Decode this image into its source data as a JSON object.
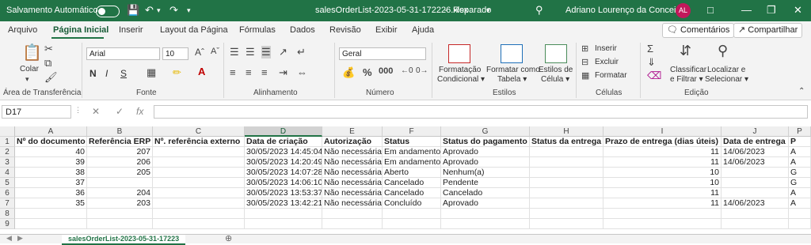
{
  "titlebar": {
    "autosave_label": "Salvamento Automático",
    "filename": "salesOrderList-2023-05-31-172226.xlsx",
    "status": "Reparado",
    "user_name": "Adriano Lourenço da Conceição",
    "user_initials": "AL"
  },
  "menu": {
    "items": [
      "Arquivo",
      "Página Inicial",
      "Inserir",
      "Layout da Página",
      "Fórmulas",
      "Dados",
      "Revisão",
      "Exibir",
      "Ajuda"
    ],
    "active": "Página Inicial",
    "comments_label": "Comentários",
    "share_label": "Compartilhar"
  },
  "ribbon": {
    "clipboard": {
      "paste_label": "Colar",
      "group_label": "Área de Transferência"
    },
    "font": {
      "font_name": "Arial",
      "font_size": "10",
      "bold": "N",
      "italic": "I",
      "underline": "S",
      "group_label": "Fonte"
    },
    "alignment": {
      "group_label": "Alinhamento"
    },
    "number": {
      "format": "Geral",
      "group_label": "Número"
    },
    "styles": {
      "conditional": [
        "Formatação",
        "Condicional ▾"
      ],
      "as_table": [
        "Formatar como",
        "Tabela ▾"
      ],
      "cell_styles": [
        "Estilos de",
        "Célula ▾"
      ],
      "group_label": "Estilos"
    },
    "cells": {
      "insert": "Inserir",
      "delete": "Excluir",
      "format": "Formatar",
      "group_label": "Células"
    },
    "editing": {
      "sort_filter": [
        "Classificar",
        "e Filtrar ▾"
      ],
      "find_select": [
        "Localizar e",
        "Selecionar ▾"
      ],
      "group_label": "Edição"
    }
  },
  "formula_bar": {
    "cell_ref": "D17",
    "fx": "fx",
    "value": ""
  },
  "sheet": {
    "columns": [
      "A",
      "B",
      "C",
      "D",
      "E",
      "F",
      "G",
      "H",
      "I",
      "J",
      "P"
    ],
    "selected_column": "D",
    "row_numbers": [
      "1",
      "2",
      "3",
      "4",
      "5",
      "6",
      "7",
      "8",
      "9"
    ],
    "header_row": [
      "Nº do documento",
      "Referência ERP",
      "Nº. referência externo",
      "Data de criação",
      "Autorização",
      "Status",
      "Status do pagamento",
      "Status da entrega",
      "Prazo de entrega (dias úteis)",
      "Data de entrega",
      "P"
    ],
    "rows": [
      [
        "40",
        "207",
        "",
        "30/05/2023 14:45:04",
        "Não necessária",
        "Em andamento",
        "Aprovado",
        "",
        "11",
        "14/06/2023",
        "A"
      ],
      [
        "39",
        "206",
        "",
        "30/05/2023 14:20:49",
        "Não necessária",
        "Em andamento",
        "Aprovado",
        "",
        "11",
        "14/06/2023",
        "A"
      ],
      [
        "38",
        "205",
        "",
        "30/05/2023 14:07:28",
        "Não necessária",
        "Aberto",
        "Nenhum(a)",
        "",
        "10",
        "",
        "G"
      ],
      [
        "37",
        "",
        "",
        "30/05/2023 14:06:10",
        "Não necessária",
        "Cancelado",
        "Pendente",
        "",
        "10",
        "",
        "G"
      ],
      [
        "36",
        "204",
        "",
        "30/05/2023 13:53:37",
        "Não necessária",
        "Cancelado",
        "Cancelado",
        "",
        "11",
        "",
        "A"
      ],
      [
        "35",
        "203",
        "",
        "30/05/2023 13:42:21",
        "Não necessária",
        "Concluído",
        "Aprovado",
        "",
        "11",
        "14/06/2023",
        "A"
      ],
      [
        "",
        "",
        "",
        "",
        "",
        "",
        "",
        "",
        "",
        "",
        ""
      ],
      [
        "",
        "",
        "",
        "",
        "",
        "",
        "",
        "",
        "",
        "",
        ""
      ]
    ],
    "tab_label": "salesOrderList-2023-05-31-17223"
  }
}
